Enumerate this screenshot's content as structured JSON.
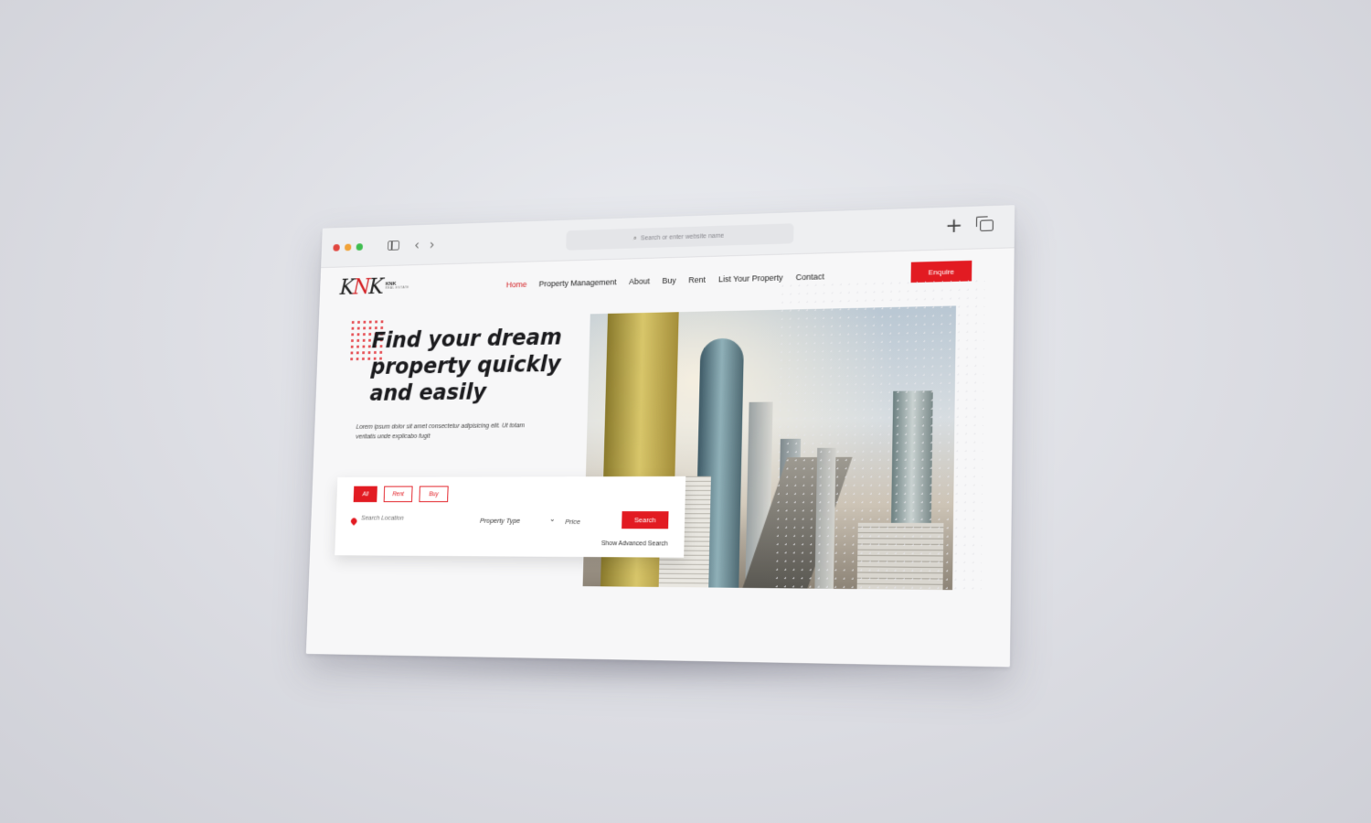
{
  "browser": {
    "url_placeholder": "Search or enter website name"
  },
  "site": {
    "logo_mark": "KNK",
    "logo_name": "KNK",
    "logo_tagline": "REAL ESTATE",
    "nav": [
      {
        "label": "Home",
        "active": true
      },
      {
        "label": "Property Management"
      },
      {
        "label": "About"
      },
      {
        "label": "Buy"
      },
      {
        "label": "Rent"
      },
      {
        "label": "List Your Property"
      },
      {
        "label": "Contact"
      }
    ],
    "enquire_label": "Enquire"
  },
  "hero": {
    "headline_1": "Find your dream",
    "headline_2": "property quickly",
    "headline_3": "and easily",
    "subtext": "Lorem ipsum dolor sit amet consectetur adipisicing elit. Ut totam veritatis unde explicabo fugit"
  },
  "search": {
    "tabs": [
      "All",
      "Rent",
      "Buy"
    ],
    "active_tab": "All",
    "location_placeholder": "Search Location",
    "property_type": "Property Type",
    "price": "Price",
    "search_label": "Search",
    "advanced_label": "Show Advanced Search"
  },
  "colors": {
    "accent": "#e21b22"
  }
}
